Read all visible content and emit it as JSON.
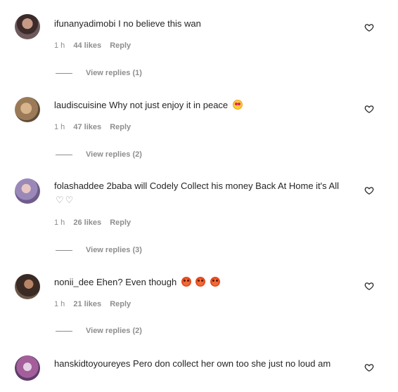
{
  "comments": [
    {
      "username": "ifunanyadimobi",
      "text": "I no believe this wan",
      "time": "1 h",
      "likes": "44 likes",
      "reply": "Reply",
      "view_replies": "View replies (1)"
    },
    {
      "username": "laudiscuisine",
      "text": "Why not just enjoy it in peace",
      "time": "1 h",
      "likes": "47 likes",
      "reply": "Reply",
      "view_replies": "View replies (2)"
    },
    {
      "username": "folashaddee",
      "text": "2baba will Codely Collect his money Back At Home it's All",
      "time": "1 h",
      "likes": "26 likes",
      "reply": "Reply",
      "view_replies": "View replies (3)"
    },
    {
      "username": "nonii_dee",
      "text": "Ehen? Even though",
      "time": "1 h",
      "likes": "21 likes",
      "reply": "Reply",
      "view_replies": "View replies (2)"
    },
    {
      "username": "hanskidtoyoureyes",
      "text": "Pero don collect her own too she just no loud am"
    }
  ],
  "colors": {
    "text": "#262626",
    "muted": "#8e8e8e"
  }
}
